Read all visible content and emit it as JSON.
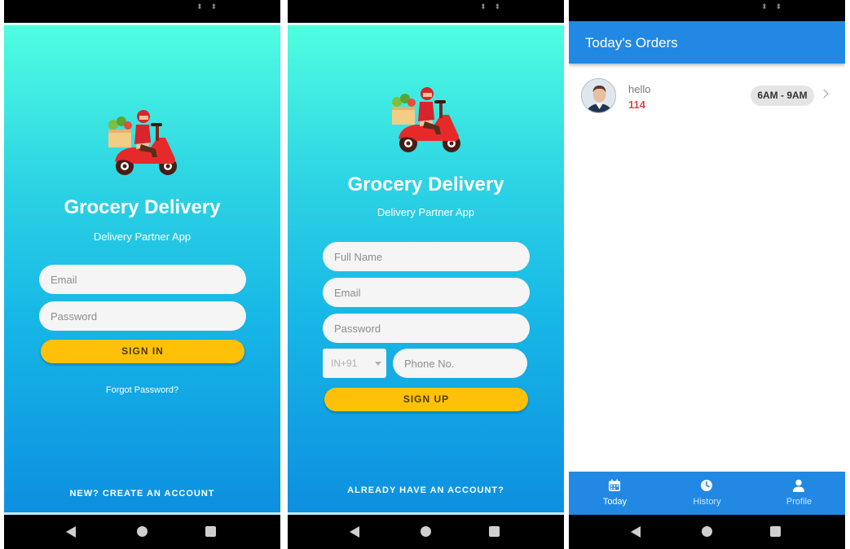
{
  "status_arrows": "⬍⬍",
  "signin_screen": {
    "title": "Grocery Delivery",
    "subtitle": "Delivery Partner App",
    "email_placeholder": "Email",
    "password_placeholder": "Password",
    "signin_label": "SIGN IN",
    "forgot_label": "Forgot Password?",
    "create_account_label": "NEW? CREATE AN ACCOUNT"
  },
  "signup_screen": {
    "title": "Grocery Delivery",
    "subtitle": "Delivery Partner App",
    "fullname_placeholder": "Full Name",
    "email_placeholder": "Email",
    "password_placeholder": "Password",
    "country_code": "IN+91",
    "phone_placeholder": "Phone No.",
    "signup_label": "SIGN UP",
    "have_account_label": "ALREADY HAVE AN ACCOUNT?"
  },
  "orders_screen": {
    "title": "Today's Orders",
    "orders": [
      {
        "name": "hello",
        "number": "114",
        "slot": "6AM - 9AM"
      }
    ],
    "bottom_nav": [
      {
        "label": "Today",
        "icon": "calendar-icon",
        "active": true
      },
      {
        "label": "History",
        "icon": "clock-icon",
        "active": false
      },
      {
        "label": "Profile",
        "icon": "person-icon",
        "active": false
      }
    ]
  },
  "colors": {
    "gradient_top": "#4ffee0",
    "gradient_bottom": "#0d8fe0",
    "button_yellow": "#fec107",
    "app_bar_blue": "#2189e4",
    "order_number_red": "#e2434f"
  }
}
